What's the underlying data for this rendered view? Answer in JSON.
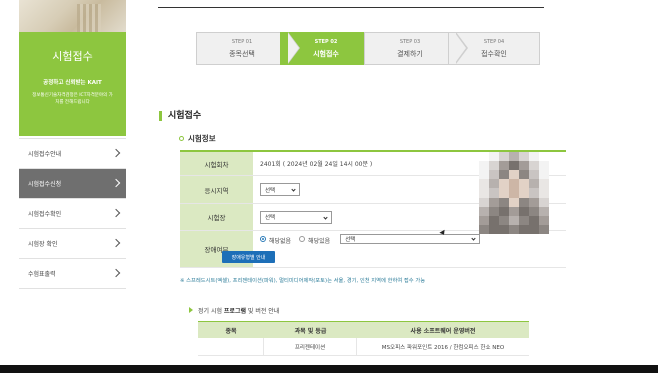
{
  "sidebar": {
    "title": "시험접수",
    "slogan": "공정하고 신뢰받는 KAIT",
    "desc": "정보통신기술자격검정은 ICT자격분야의 가치를 전해드립니다",
    "items": [
      {
        "label": "시험접수안내",
        "active": false
      },
      {
        "label": "시험접수신청",
        "active": true
      },
      {
        "label": "시험접수확인",
        "active": false
      },
      {
        "label": "시험장 확인",
        "active": false
      },
      {
        "label": "수험표출력",
        "active": false
      }
    ]
  },
  "steps": [
    {
      "no": "STEP 01",
      "name": "종목선택",
      "active": false
    },
    {
      "no": "STEP 02",
      "name": "시험접수",
      "active": true
    },
    {
      "no": "STEP 03",
      "name": "결제하기",
      "active": false
    },
    {
      "no": "STEP 04",
      "name": "접수확인",
      "active": false
    }
  ],
  "section_title": "시험접수",
  "sub_title": "시험정보",
  "form": {
    "round_label": "시험회차",
    "round_value": "2401회 ( 2024년 02월 24일 14시 00분 )",
    "area_label": "응시지역",
    "area_select": "선택",
    "site_label": "시험장",
    "site_select": "선택",
    "disability_label": "장애여부",
    "radio_none": "해당없음",
    "radio_yes": "해당있음",
    "disability_select": "선택",
    "guide_button": "장애유형별 안내"
  },
  "note": "※ 스프레드시트(엑셀), 프리젠테이션(파워), 멀티미디어제작(포토)는 서울, 경기, 인천 지역에 한하여 접수 가능",
  "guide": {
    "prefix": "정기 시험 ",
    "bold": "프로그램",
    "suffix": " 및 버전 안내"
  },
  "sw_table": {
    "headers": [
      "종목",
      "과목 및 등급",
      "사용 소프트웨어 운영버전"
    ],
    "rows": [
      [
        "",
        "프리젠테이션",
        "MS오피스 파워포인트 2016 / 한컴오피스 한쇼 NEO"
      ]
    ]
  }
}
